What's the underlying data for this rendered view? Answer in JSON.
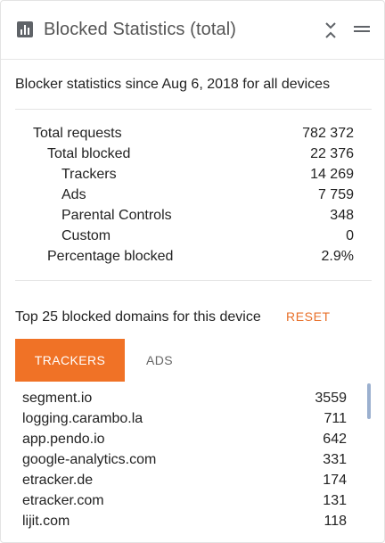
{
  "header": {
    "title": "Blocked Statistics (total)",
    "icons": [
      "bar-chart-icon",
      "collapse-icon",
      "menu-icon"
    ]
  },
  "summary": {
    "since_text": "Blocker statistics since Aug 6, 2018 for all devices"
  },
  "stats": [
    {
      "label": "Total requests",
      "value": "782 372",
      "level": 0
    },
    {
      "label": "Total blocked",
      "value": "22 376",
      "level": 1
    },
    {
      "label": "Trackers",
      "value": "14 269",
      "level": 2
    },
    {
      "label": "Ads",
      "value": "7 759",
      "level": 2
    },
    {
      "label": "Parental Controls",
      "value": "348",
      "level": 2
    },
    {
      "label": "Custom",
      "value": "0",
      "level": 2
    },
    {
      "label": "Percentage blocked",
      "value": "2.9%",
      "level": 1
    }
  ],
  "top_domains": {
    "label": "Top 25 blocked domains for this device",
    "reset_label": "RESET",
    "tabs": [
      {
        "label": "TRACKERS",
        "active": true
      },
      {
        "label": "ADS",
        "active": false
      }
    ],
    "rows": [
      {
        "domain": "segment.io",
        "count": "3559"
      },
      {
        "domain": "logging.carambo.la",
        "count": "711"
      },
      {
        "domain": "app.pendo.io",
        "count": "642"
      },
      {
        "domain": "google-analytics.com",
        "count": "331"
      },
      {
        "domain": "etracker.de",
        "count": "174"
      },
      {
        "domain": "etracker.com",
        "count": "131"
      },
      {
        "domain": "lijit.com",
        "count": "118"
      }
    ]
  },
  "colors": {
    "accent": "#f07226",
    "reset": "#e8702a",
    "icon": "#5f6368",
    "scroll_thumb": "#9bb0cf"
  }
}
